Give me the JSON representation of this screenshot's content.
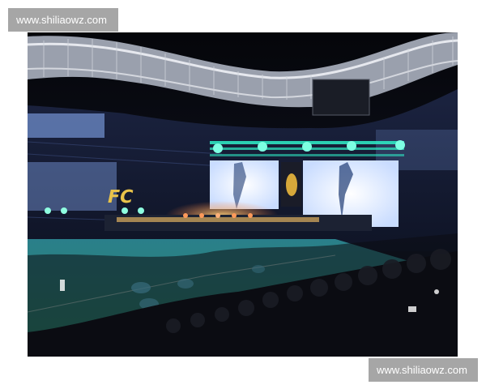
{
  "watermark": {
    "top_text": "www.shiliaowz.com",
    "bottom_text": "www.shiliaowz.com"
  },
  "photo": {
    "subject": "stadium-concert-photo",
    "banner_text": "FC",
    "colors": {
      "sky": "#0a0b12",
      "roof": "#c9ccd4",
      "stage_light": "#2ff0c8",
      "screen": "#e6eefc",
      "field": "#1e8f4a",
      "crowd": "#0b0c12",
      "glow": "#e0c06a"
    }
  }
}
